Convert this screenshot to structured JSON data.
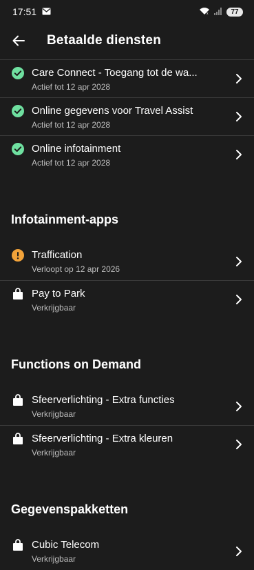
{
  "status_bar": {
    "time": "17:51",
    "battery": "77",
    "icons": [
      "mail-icon",
      "wifi-icon",
      "signal-icon"
    ]
  },
  "header": {
    "title": "Betaalde diensten",
    "back_icon": "arrow-left-icon"
  },
  "services": [
    {
      "title": "Care Connect - Toegang tot de wa...",
      "subtitle": "Actief tot 12 apr 2028",
      "icon": "check-circle-icon"
    },
    {
      "title": "Online gegevens voor Travel Assist",
      "subtitle": "Actief tot 12 apr 2028",
      "icon": "check-circle-icon"
    },
    {
      "title": "Online infotainment",
      "subtitle": "Actief tot 12 apr 2028",
      "icon": "check-circle-icon"
    }
  ],
  "infotainment": {
    "heading": "Infotainment-apps",
    "items": [
      {
        "title": "Traffication",
        "subtitle": "Verloopt op 12 apr 2026",
        "icon": "warning-circle-icon"
      },
      {
        "title": "Pay to Park",
        "subtitle": "Verkrijgbaar",
        "icon": "shopping-bag-icon"
      }
    ]
  },
  "fod": {
    "heading": "Functions on Demand",
    "items": [
      {
        "title": "Sfeerverlichting - Extra functies",
        "subtitle": "Verkrijgbaar",
        "icon": "shopping-bag-icon"
      },
      {
        "title": "Sfeerverlichting - Extra kleuren",
        "subtitle": "Verkrijgbaar",
        "icon": "shopping-bag-icon"
      }
    ]
  },
  "data_packages": {
    "heading": "Gegevenspakketten",
    "items": [
      {
        "title": "Cubic Telecom",
        "subtitle": "Verkrijgbaar",
        "icon": "shopping-bag-icon"
      }
    ]
  },
  "colors": {
    "background": "#1c1c1c",
    "active_green": "#6fe0a0",
    "warning_orange": "#f2a33a",
    "divider": "#3a3a3a"
  }
}
